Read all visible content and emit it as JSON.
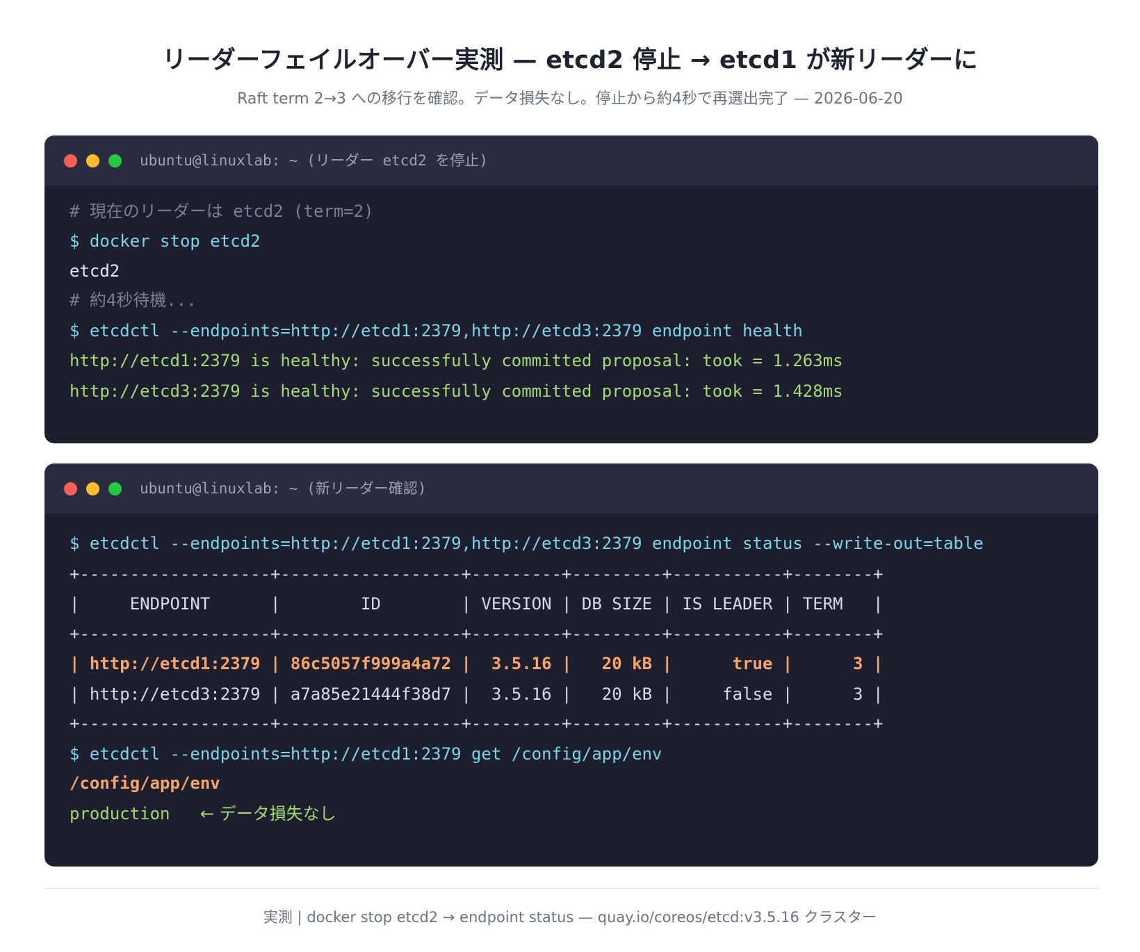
{
  "header": {
    "title": "リーダーフェイルオーバー実測 — etcd2 停止 → etcd1 が新リーダーに",
    "subtitle": "Raft term 2→3 への移行を確認。データ損失なし。停止から約4秒で再選出完了 — 2026-06-20"
  },
  "terminal1": {
    "title": "ubuntu@linuxlab: ~ (リーダー etcd2 を停止)",
    "lines": [
      "# 現在のリーダーは etcd2 (term=2)",
      "$ docker stop etcd2",
      "etcd2",
      "# 約4秒待機...",
      "$ etcdctl --endpoints=http://etcd1:2379,http://etcd3:2379 endpoint health",
      "http://etcd1:2379 is healthy: successfully committed proposal: took = 1.263ms",
      "http://etcd3:2379 is healthy: successfully committed proposal: took = 1.428ms"
    ]
  },
  "terminal2": {
    "title": "ubuntu@linuxlab: ~ (新リーダー確認)",
    "lines": [
      "$ etcdctl --endpoints=http://etcd1:2379,http://etcd3:2379 endpoint status --write-out=table",
      "+-------------------+------------------+---------+---------+-----------+--------+",
      "|     ENDPOINT      |        ID        | VERSION | DB SIZE | IS LEADER | TERM   |",
      "+-------------------+------------------+---------+---------+-----------+--------+",
      "| http://etcd1:2379 | 86c5057f999a4a72 |  3.5.16 |   20 kB |      true |      3 |",
      "| http://etcd3:2379 | a7a85e21444f38d7 |  3.5.16 |   20 kB |     false |      3 |",
      "+-------------------+------------------+---------+---------+-----------+--------+",
      "$ etcdctl --endpoints=http://etcd1:2379 get /config/app/env",
      "/config/app/env",
      "production"
    ],
    "annotation": "← データ損失なし"
  },
  "footer": {
    "text": "実測 | docker stop etcd2 → endpoint status — quay.io/coreos/etcd:v3.5.16 クラスター"
  },
  "colors": {
    "terminal_bg": "#1e1f2e",
    "titlebar_bg": "#2a2c3f",
    "command": "#7dd3e8",
    "success": "#a3d977",
    "highlight": "#f5a56b",
    "comment": "#7b7f96"
  }
}
